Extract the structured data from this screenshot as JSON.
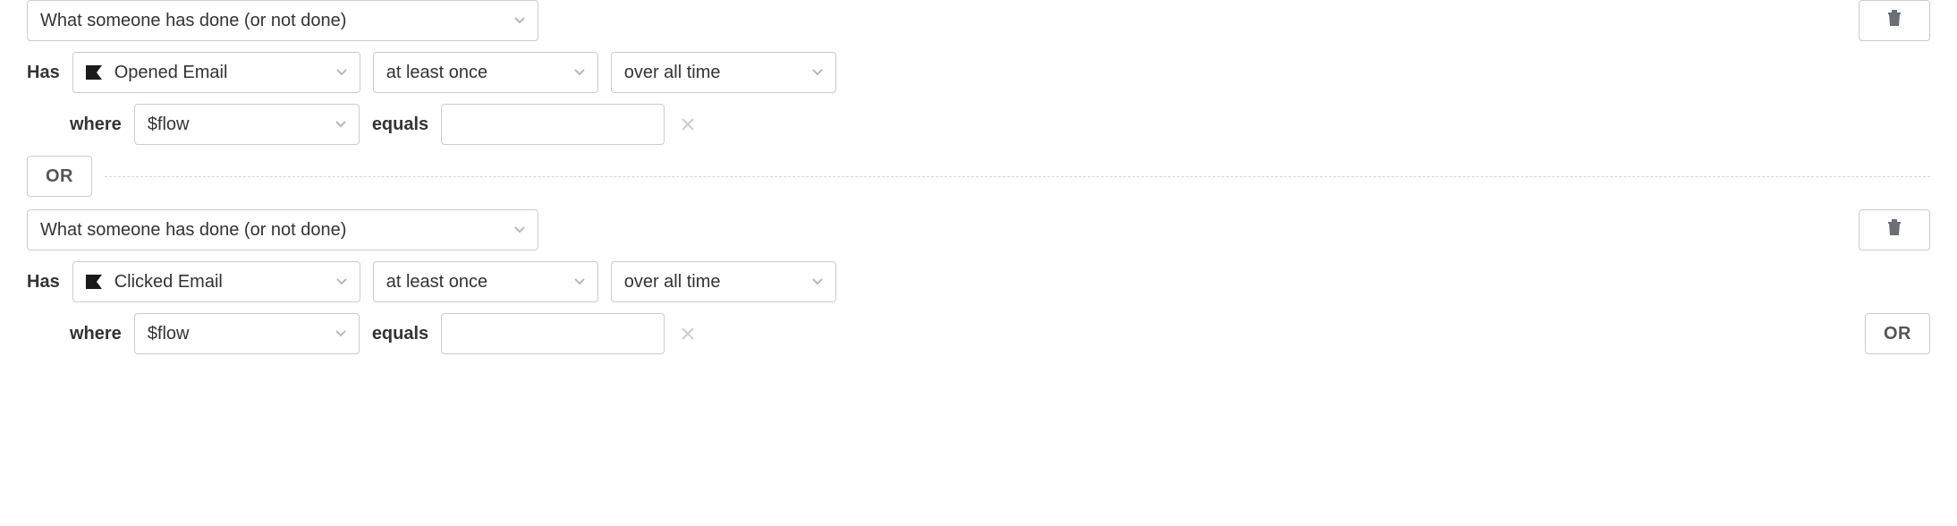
{
  "conditions": [
    {
      "type_label": "What someone has done (or not done)",
      "has_label": "Has",
      "event": "Opened Email",
      "frequency": "at least once",
      "timeframe": "over all time",
      "where_label": "where",
      "field": "$flow",
      "equals_label": "equals",
      "value": ""
    },
    {
      "type_label": "What someone has done (or not done)",
      "has_label": "Has",
      "event": "Clicked Email",
      "frequency": "at least once",
      "timeframe": "over all time",
      "where_label": "where",
      "field": "$flow",
      "equals_label": "equals",
      "value": ""
    }
  ],
  "or_label": "OR"
}
